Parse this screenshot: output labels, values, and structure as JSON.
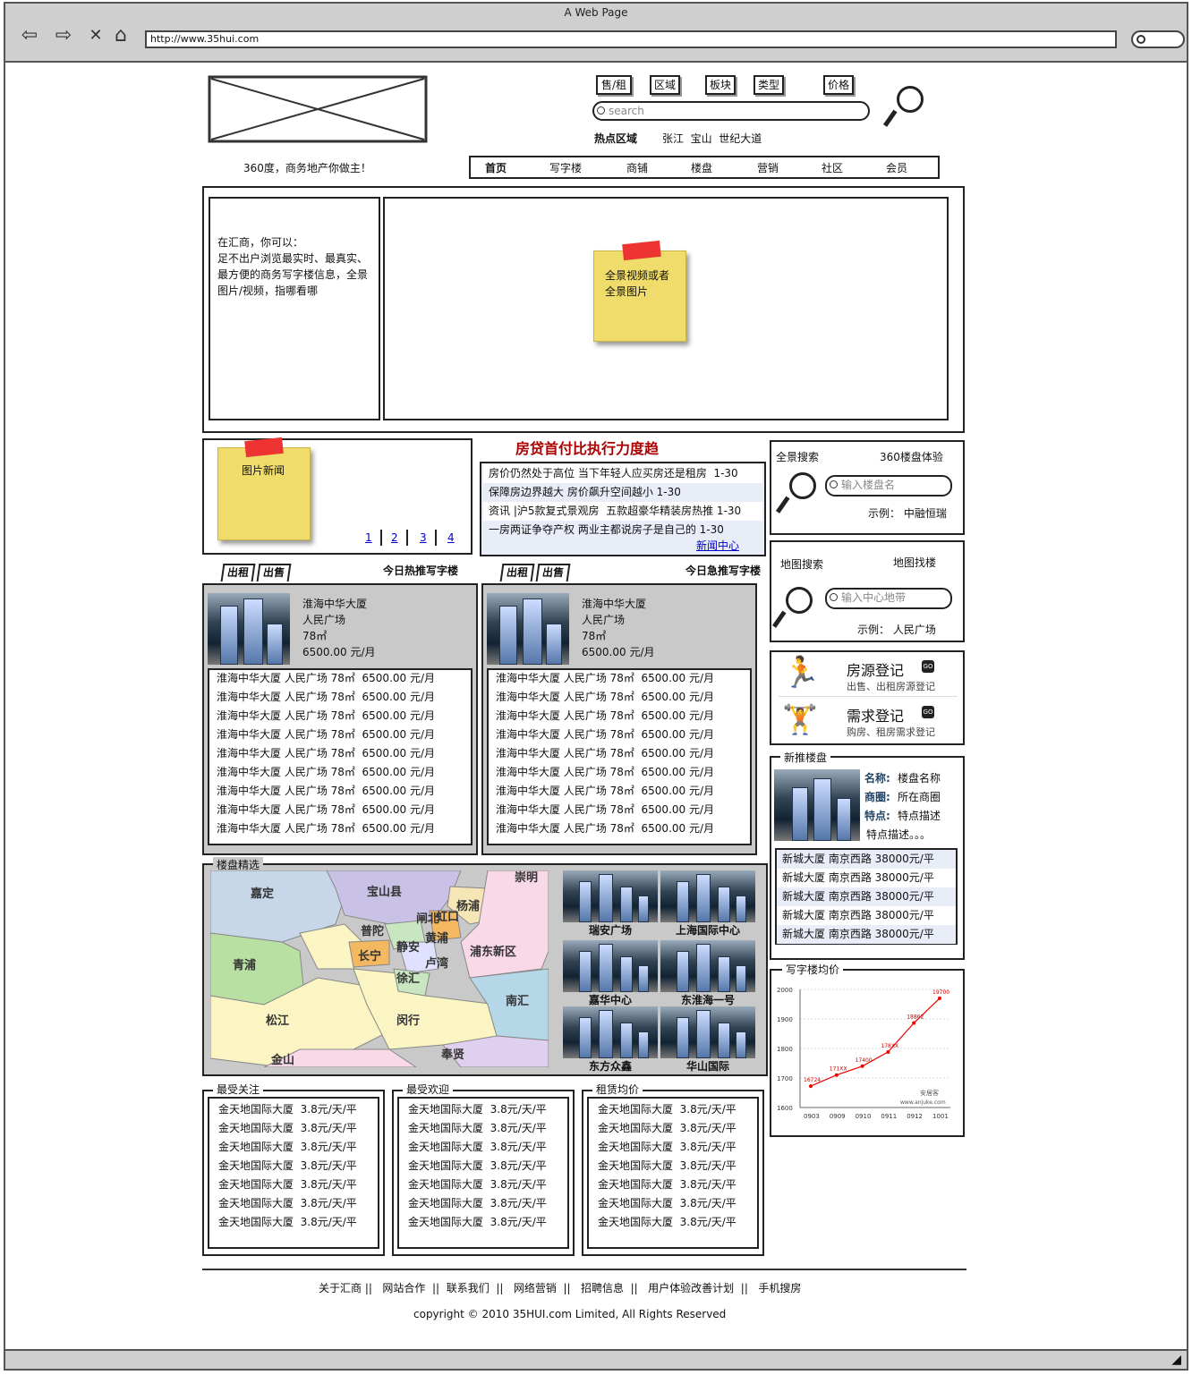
{
  "window": {
    "title": "A Web Page",
    "url": "http://www.35hui.com"
  },
  "header": {
    "tabs": [
      "售/租",
      "区域",
      "板块",
      "类型",
      "价格"
    ],
    "search_placeholder": "search",
    "hot_label": "热点区域",
    "hot_areas": "张江  宝山  世纪大道",
    "slogan": "360度，商务地产你做主！",
    "nav": [
      "首页",
      "写字楼",
      "商铺",
      "楼盘",
      "营销",
      "社区",
      "会员"
    ]
  },
  "intro": {
    "text": "在汇商，你可以：\n足不出户浏览最实时、最真实、最方便的商务写字楼信息，全景图片/视频，指哪看哪",
    "note": "全景视频或者\n全景图片"
  },
  "picnews": {
    "note": "图片新闻",
    "pages": [
      "1",
      "2",
      "3",
      "4"
    ]
  },
  "news": {
    "headline": "房贷首付比执行力度趋",
    "items": [
      "房价仍然处于高位 当下年轻人应买房还是租房  1-30",
      "保障房边界越大 房价飙升空间越小 1-30",
      "资讯 |沪5款复式景观房  五款超豪华精装房热推 1-30",
      "一房两证争夺产权 两业主都说房子是自己的 1-30"
    ],
    "more": "新闻中心"
  },
  "panorama_search": {
    "title": "全景搜索",
    "subtitle": "360楼盘体验",
    "placeholder": "输入楼盘名",
    "example": "示例：  中融恒瑞"
  },
  "map_search": {
    "title": "地图搜索",
    "subtitle": "地图找楼",
    "placeholder": "输入中心地带",
    "example": "示例：  人民广场"
  },
  "register": [
    {
      "title": "房源登记",
      "desc": "出售、出租房源登记",
      "go": "GO"
    },
    {
      "title": "需求登记",
      "desc": "购房、租房需求登记",
      "go": "GO"
    }
  ],
  "hot_left": {
    "tabs": [
      "出租",
      "出售"
    ],
    "title": "今日热推写字楼",
    "feature": [
      "淮海中华大厦",
      "人民广场",
      "78㎡",
      "6500.00 元/月"
    ],
    "items": [
      "淮海中华大厦 人民广场 78㎡  6500.00 元/月",
      "淮海中华大厦 人民广场 78㎡  6500.00 元/月",
      "淮海中华大厦 人民广场 78㎡  6500.00 元/月",
      "淮海中华大厦 人民广场 78㎡  6500.00 元/月",
      "淮海中华大厦 人民广场 78㎡  6500.00 元/月",
      "淮海中华大厦 人民广场 78㎡  6500.00 元/月",
      "淮海中华大厦 人民广场 78㎡  6500.00 元/月",
      "淮海中华大厦 人民广场 78㎡  6500.00 元/月",
      "淮海中华大厦 人民广场 78㎡  6500.00 元/月"
    ]
  },
  "hot_right": {
    "tabs": [
      "出租",
      "出售"
    ],
    "title": "今日急推写字楼",
    "feature": [
      "淮海中华大厦",
      "人民广场",
      "78㎡",
      "6500.00 元/月"
    ],
    "items": [
      "淮海中华大厦 人民广场 78㎡  6500.00 元/月",
      "淮海中华大厦 人民广场 78㎡  6500.00 元/月",
      "淮海中华大厦 人民广场 78㎡  6500.00 元/月",
      "淮海中华大厦 人民广场 78㎡  6500.00 元/月",
      "淮海中华大厦 人民广场 78㎡  6500.00 元/月",
      "淮海中华大厦 人民广场 78㎡  6500.00 元/月",
      "淮海中华大厦 人民广场 78㎡  6500.00 元/月",
      "淮海中华大厦 人民广场 78㎡  6500.00 元/月",
      "淮海中华大厦 人民广场 78㎡  6500.00 元/月"
    ]
  },
  "new_projects": {
    "title": "新推楼盘",
    "fields": [
      {
        "k": "名称:",
        "v": "楼盘名称"
      },
      {
        "k": "商圈:",
        "v": "所在商圈"
      },
      {
        "k": "特点:",
        "v": "特点描述"
      }
    ],
    "extra": "特点描述。。。",
    "items": [
      "新城大厦 南京西路 38000元/平",
      "新城大厦 南京西路 38000元/平",
      "新城大厦 南京西路 38000元/平",
      "新城大厦 南京西路 38000元/平",
      "新城大厦 南京西路 38000元/平"
    ]
  },
  "selected": {
    "title": "楼盘精选",
    "districts": [
      "崇明",
      "嘉定",
      "宝山县",
      "杨浦",
      "虹口",
      "闸北",
      "普陀",
      "静安",
      "黄浦",
      "卢湾",
      "长宁",
      "浦东新区",
      "青浦",
      "徐汇",
      "南汇",
      "松江",
      "闵行",
      "奉贤",
      "金山"
    ],
    "buildings": [
      "瑞安广场",
      "上海国际中心",
      "嘉华中心",
      "东淮海一号",
      "东方众鑫",
      "华山国际"
    ]
  },
  "price_chart": {
    "title": "写字楼均价",
    "watermark": "安居客\nwww.anjuke.com"
  },
  "chart_data": {
    "type": "line",
    "categories": [
      "0903",
      "0909",
      "0910",
      "0911",
      "0912",
      "1001"
    ],
    "y_ticks": [
      "2000",
      "1900",
      "1800",
      "1700",
      "1600"
    ],
    "series": [
      {
        "values": [
          16724,
          17100,
          17400,
          17880,
          18862,
          19700
        ]
      }
    ],
    "point_labels": [
      "16724",
      "171XX",
      "17400",
      "178XX",
      "18862",
      "19700"
    ],
    "ylim": [
      16000,
      20000
    ]
  },
  "bottom_lists": [
    {
      "title": "最受关注",
      "items": [
        "金天地国际大厦  3.8元/天/平",
        "金天地国际大厦  3.8元/天/平",
        "金天地国际大厦  3.8元/天/平",
        "金天地国际大厦  3.8元/天/平",
        "金天地国际大厦  3.8元/天/平",
        "金天地国际大厦  3.8元/天/平",
        "金天地国际大厦  3.8元/天/平"
      ]
    },
    {
      "title": "最受欢迎",
      "items": [
        "金天地国际大厦  3.8元/天/平",
        "金天地国际大厦  3.8元/天/平",
        "金天地国际大厦  3.8元/天/平",
        "金天地国际大厦  3.8元/天/平",
        "金天地国际大厦  3.8元/天/平",
        "金天地国际大厦  3.8元/天/平",
        "金天地国际大厦  3.8元/天/平"
      ]
    },
    {
      "title": "租赁均价",
      "items": [
        "金天地国际大厦  3.8元/天/平",
        "金天地国际大厦  3.8元/天/平",
        "金天地国际大厦  3.8元/天/平",
        "金天地国际大厦  3.8元/天/平",
        "金天地国际大厦  3.8元/天/平",
        "金天地国际大厦  3.8元/天/平",
        "金天地国际大厦  3.8元/天/平"
      ]
    }
  ],
  "footer": {
    "links": "关于汇商 ||   网站合作  ||  联系我们  ||   网络营销  ||   招聘信息  ||   用户体验改善计划  ||   手机搜房",
    "copyright": "copyright © 2010 35HUI.com Limited, All Rights Reserved"
  }
}
